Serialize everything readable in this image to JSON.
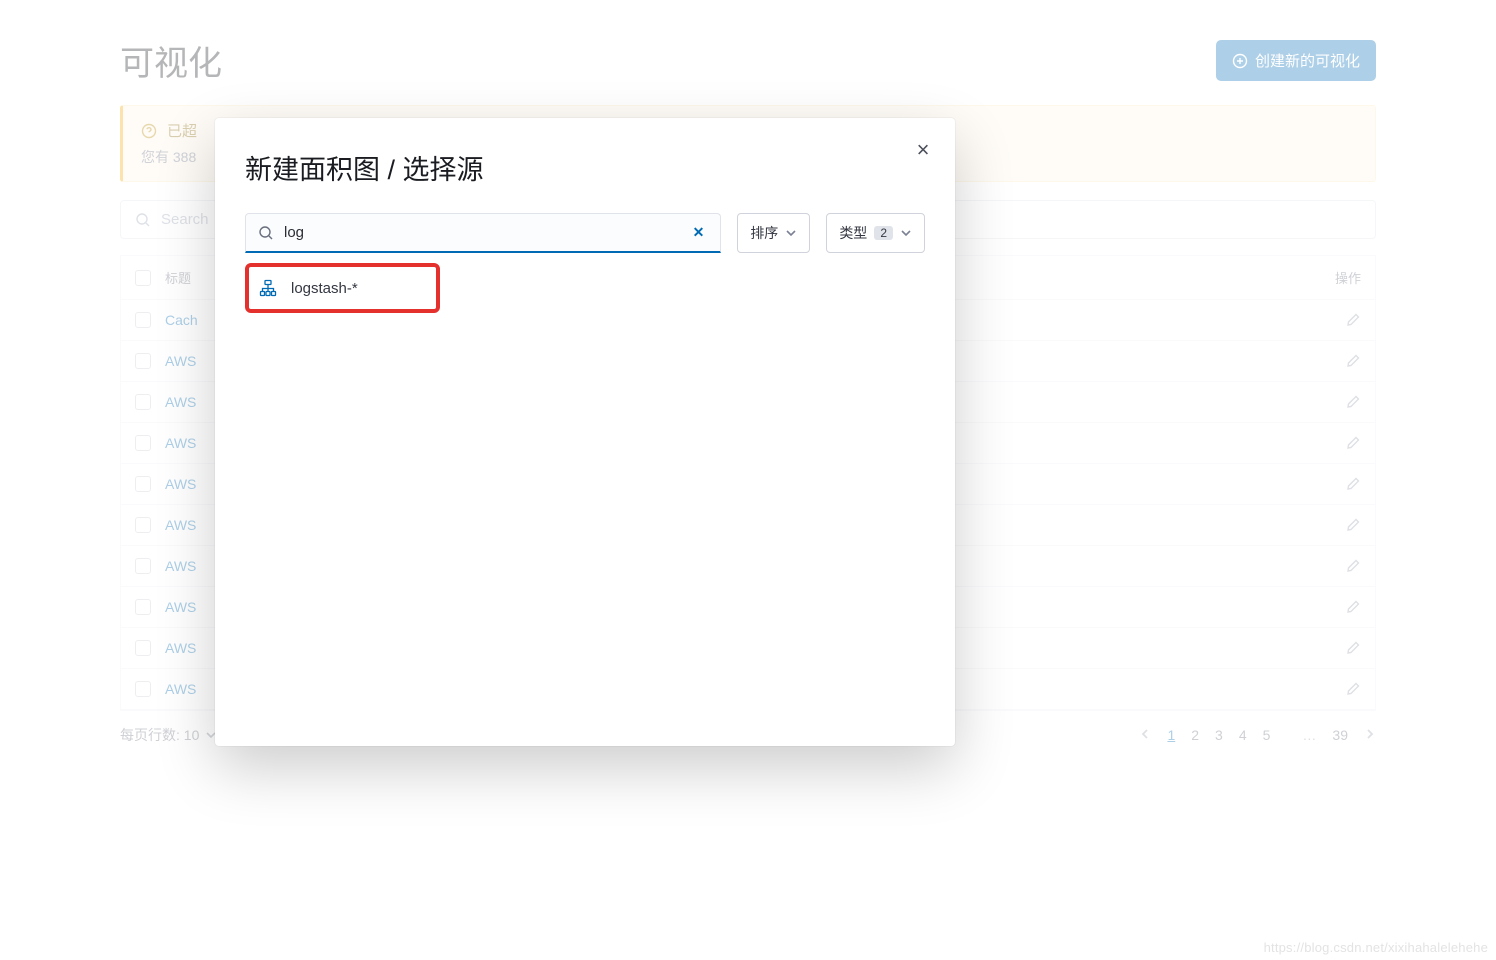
{
  "page": {
    "title": "可视化",
    "create_label": "创建新的可视化"
  },
  "callout": {
    "title": "已超",
    "subtitle": "您有 388"
  },
  "search": {
    "placeholder": "Search"
  },
  "table": {
    "header_title": "标题",
    "header_actions": "操作",
    "rows": [
      {
        "title": "Cach"
      },
      {
        "title": "AWS"
      },
      {
        "title": "AWS"
      },
      {
        "title": "AWS"
      },
      {
        "title": "AWS"
      },
      {
        "title": "AWS"
      },
      {
        "title": "AWS"
      },
      {
        "title": "AWS"
      },
      {
        "title": "AWS"
      },
      {
        "title": "AWS"
      }
    ]
  },
  "footer": {
    "rows_per_label": "每页行数: 10",
    "pages": [
      "1",
      "2",
      "3",
      "4",
      "5"
    ],
    "ellipsis": "…",
    "last_page": "39"
  },
  "modal": {
    "title": "新建面积图 / 选择源",
    "search_value": "log",
    "sort_label": "排序",
    "type_label": "类型",
    "type_badge": "2",
    "result": "logstash-*",
    "close": "×"
  },
  "watermark": "https://blog.csdn.net/xixihahalelehehe"
}
